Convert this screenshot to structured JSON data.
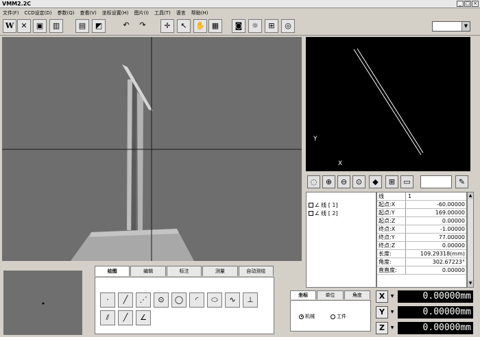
{
  "window": {
    "title": "VMM2.2C",
    "controls": [
      "_",
      "□",
      "×"
    ]
  },
  "menu": [
    "文件(F)",
    "CCD设定(D)",
    "参数(Q)",
    "查看(V)",
    "坐标设置(H)",
    "图片(I)",
    "工具(T)",
    "语言",
    "帮助(H)"
  ],
  "cad_view": {
    "y_label": "Y",
    "x_label": "X"
  },
  "entity_list": [
    {
      "label": "线 [ 1]"
    },
    {
      "label": "线 [ 2]"
    }
  ],
  "properties": {
    "header": {
      "key": "线",
      "value": "1"
    },
    "rows": [
      {
        "key": "起点:X",
        "value": "-60.00000"
      },
      {
        "key": "起点:Y",
        "value": "169.00000"
      },
      {
        "key": "起点:Z",
        "value": "0.00000"
      },
      {
        "key": "终点:X",
        "value": "-1.00000"
      },
      {
        "key": "终点:Y",
        "value": "77.00000"
      },
      {
        "key": "终点:Z",
        "value": "0.00000"
      },
      {
        "key": "长度:",
        "value": "109.29318(mm)"
      },
      {
        "key": "角度:",
        "value": "302.67223°"
      },
      {
        "key": "直直度:",
        "value": "0.00000"
      }
    ]
  },
  "tabs": [
    "绘图",
    "编辑",
    "标注",
    "测量",
    "自动测绘"
  ],
  "coord_tabs": [
    "坐标",
    "单位",
    "角度"
  ],
  "coord_radios": [
    {
      "label": "机械",
      "checked": true
    },
    {
      "label": "工件",
      "checked": false
    }
  ],
  "dro": [
    {
      "axis": "X",
      "value": "0.00000mm"
    },
    {
      "axis": "Y",
      "value": "0.00000mm"
    },
    {
      "axis": "Z",
      "value": "0.00000mm"
    }
  ]
}
